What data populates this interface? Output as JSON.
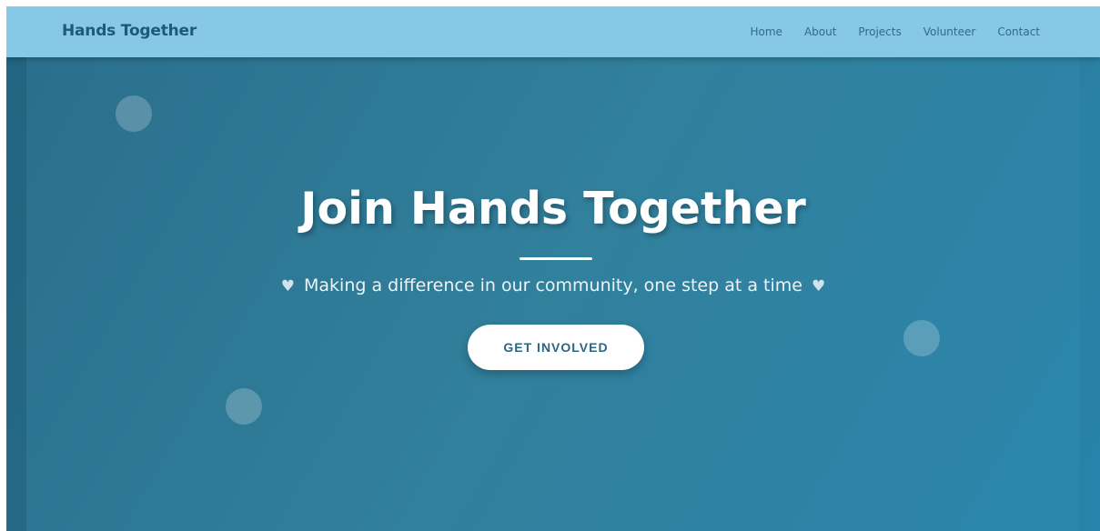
{
  "nav": {
    "brand": "Hands Together",
    "links": [
      "Home",
      "About",
      "Projects",
      "Volunteer",
      "Contact"
    ]
  },
  "hero": {
    "title": "Join Hands Together",
    "tagline": "Making a difference in our community, one step at a time",
    "cta_label": "GET INVOLVED",
    "heart_icon": "heart-icon"
  },
  "colors": {
    "navbar": "#86c8e6",
    "brand_text": "#1d5a7c",
    "hero_start": "#2a6f8c",
    "hero_end": "#2b86ad",
    "cta_text": "#2c6580"
  }
}
